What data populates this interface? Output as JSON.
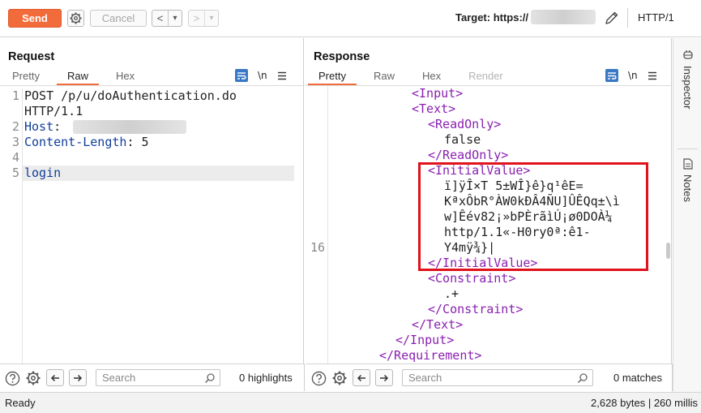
{
  "toolbar": {
    "send_label": "Send",
    "cancel_label": "Cancel",
    "back_label": "<",
    "back_menu_label": "▾",
    "forward_label": ">",
    "forward_menu_label": "▾",
    "target_label": "Target: https://",
    "http_version": "HTTP/1"
  },
  "request": {
    "title": "Request",
    "tabs": [
      {
        "label": "Pretty",
        "active": false
      },
      {
        "label": "Raw",
        "active": true
      },
      {
        "label": "Hex",
        "active": false
      }
    ],
    "newline_toggle_label": "\\n",
    "lines": [
      {
        "num": "1",
        "text": "POST /p/u/doAuthentication.do"
      },
      {
        "num": "",
        "text": "HTTP/1.1"
      },
      {
        "num": "2",
        "key": "Host",
        "sep": ":"
      },
      {
        "num": "3",
        "key": "Content-Length",
        "sep": ":",
        "value": " 5"
      },
      {
        "num": "4",
        "text": ""
      },
      {
        "num": "5",
        "key": "login"
      }
    ],
    "search_placeholder": "Search",
    "highlights": "0 highlights"
  },
  "response": {
    "title": "Response",
    "tabs": [
      {
        "label": "Pretty",
        "active": true
      },
      {
        "label": "Raw",
        "active": false
      },
      {
        "label": "Hex",
        "active": false
      },
      {
        "label": "Render",
        "active": false,
        "disabled": true
      }
    ],
    "newline_toggle_label": "\\n",
    "line_number": "16",
    "lines": [
      {
        "t": "<Input>"
      },
      {
        "t": "<Text>"
      },
      {
        "t": "<ReadOnly>"
      },
      {
        "t": "false"
      },
      {
        "t": "</ReadOnly>"
      },
      {
        "t": "<InitialValue>"
      },
      {
        "t": "ï]ÿÎ×T 5±WÎ}ê}q¹êE="
      },
      {
        "t": "KªxÔbR°ÀW0kĐÂ4ÑU]ÛÊQq±\\ì"
      },
      {
        "t": "w]Êév82¡»bPÈrãìÚ¡ø0DOÀ¼"
      },
      {
        "t": "http/1.1«-H0ry0ª:ê1-"
      },
      {
        "t": "Y4mÿ¾}|"
      },
      {
        "t": "</InitialValue>"
      },
      {
        "t": "<Constraint>"
      },
      {
        "t": ".+"
      },
      {
        "t": "</Constraint>"
      },
      {
        "t": "</Text>"
      },
      {
        "t": "</Input>"
      },
      {
        "t": "</Requirement>"
      }
    ],
    "search_placeholder": "Search",
    "matches": "0 matches"
  },
  "sidebar": {
    "inspector_label": "Inspector",
    "notes_label": "Notes"
  },
  "status": {
    "left": "Ready",
    "right": "2,628 bytes | 260 millis"
  },
  "colors": {
    "accent": "#f26b3a",
    "tag": "#8a1fb0",
    "key": "#123e9a",
    "highlight_box": "#e0121b",
    "icon_blue": "#3b78c4"
  }
}
